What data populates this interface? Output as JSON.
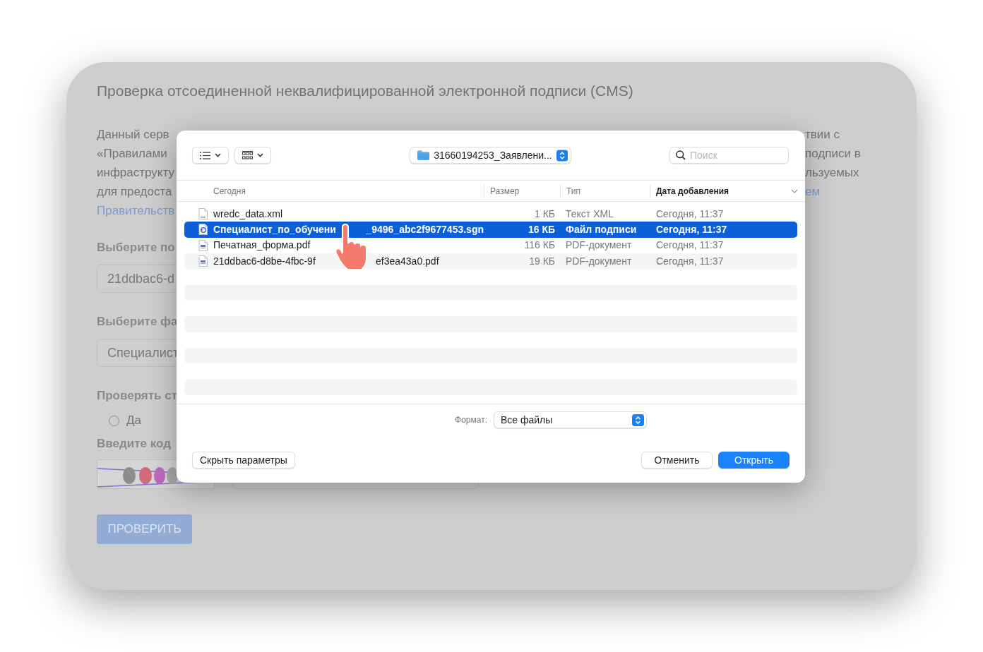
{
  "page": {
    "title": "Проверка отсоединенной неквалифицированной электронной подписи (CMS)",
    "intro_left": [
      {
        "text": "Данный серв",
        "kind": "text"
      },
      {
        "text": "«Правилами",
        "kind": "text"
      },
      {
        "text": "инфраструкту",
        "kind": "text"
      },
      {
        "text": "для предоста",
        "kind": "text"
      },
      {
        "text": "Правительств",
        "kind": "link"
      }
    ],
    "intro_right": [
      {
        "text": "твии с",
        "kind": "text"
      },
      {
        "text": "подписи в",
        "kind": "text"
      },
      {
        "text": "льзуемых",
        "kind": "text"
      },
      {
        "text": "ем",
        "kind": "link"
      }
    ],
    "fields": [
      {
        "label": "Выберите по",
        "value": "21ddbac6-d"
      },
      {
        "label": "Выберите фа",
        "value": "Специалист"
      }
    ],
    "option": {
      "label": "Проверять ст",
      "radio": {
        "label": "Да",
        "checked": false
      }
    },
    "captcha": {
      "label": "Введите код"
    },
    "submit": "ПРОВЕРИТЬ"
  },
  "dialog": {
    "path": "31660194253_Заявлени...",
    "search": {
      "placeholder": "Поиск"
    },
    "columns": [
      {
        "label": "Сегодня",
        "sorted": false
      },
      {
        "label": "Размер",
        "sorted": false
      },
      {
        "label": "Тип",
        "sorted": false
      },
      {
        "label": "Дата добавления",
        "sorted": true
      }
    ],
    "files": [
      {
        "kind": "xml",
        "name_parts": [
          "wredc_data.xml"
        ],
        "size": "1 КБ",
        "type": "Текст XML",
        "date": "Сегодня, 11:37",
        "selected": false
      },
      {
        "kind": "signature",
        "name_parts": [
          "Специалист_по_обучени",
          "_9496_abc2f9677453.sgn"
        ],
        "size": "16 КБ",
        "type": "Файл подписи",
        "date": "Сегодня, 11:37",
        "selected": true
      },
      {
        "kind": "pdf",
        "name_parts": [
          "Печатная_форма.pdf"
        ],
        "size": "116 КБ",
        "type": "PDF-документ",
        "date": "Сегодня, 11:37",
        "selected": false
      },
      {
        "kind": "pdf",
        "name_parts": [
          "21ddbac6-d8be-4fbc-9f",
          "ef3ea43a0.pdf"
        ],
        "size": "19 КБ",
        "type": "PDF-документ",
        "date": "Сегодня, 11:37",
        "selected": false
      }
    ],
    "format": {
      "label": "Формат:",
      "value": "Все файлы"
    },
    "options_button": "Скрыть параметры",
    "buttons": [
      {
        "label": "Отменить",
        "kind": "secondary"
      },
      {
        "label": "Открыть",
        "kind": "primary"
      }
    ]
  }
}
